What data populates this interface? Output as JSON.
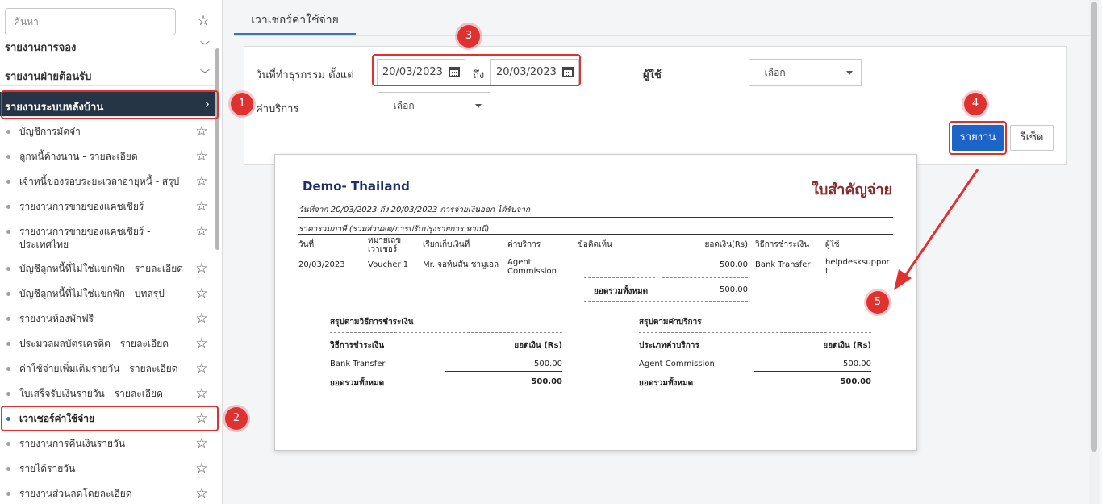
{
  "sidebar": {
    "search_placeholder": "ค้นหา",
    "sections": [
      {
        "label": "รายงานการจอง"
      },
      {
        "label": "รายงานฝ่ายต้อนรับ"
      },
      {
        "label": "รายงานระบบหลังบ้าน"
      }
    ],
    "items": [
      {
        "label": "บัญชีการมัดจำ"
      },
      {
        "label": "ลูกหนี้ค้างนาน - รายละเอียด"
      },
      {
        "label": "เจ้าหนี้ของรอบระยะเวลาอายุหนี้ - สรุป"
      },
      {
        "label": "รายงานการขายของแคชเชียร์"
      },
      {
        "label": "รายงานการขายของแคชเชียร์ -",
        "label2": "ประเทศไทย"
      },
      {
        "label": "บัญชีลูกหนี้ที่ไม่ใช่แขกพัก - รายละเอียด"
      },
      {
        "label": "บัญชีลูกหนี้ที่ไม่ใช่แขกพัก - บทสรุป"
      },
      {
        "label": "รายงานห้องพักฟรี"
      },
      {
        "label": "ประมวลผลบัตรเครดิต - รายละเอียด"
      },
      {
        "label": "ค่าใช้จ่ายเพิ่มเติมรายวัน - รายละเอียด"
      },
      {
        "label": "ใบเสร็จรับเงินรายวัน - รายละเอียด"
      },
      {
        "label": "เวาเชอร์ค่าใช้จ่าย"
      },
      {
        "label": "รายงานการคืนเงินรายวัน"
      },
      {
        "label": "รายได้รายวัน"
      },
      {
        "label": "รายงานส่วนลดโดยละเอียด"
      }
    ]
  },
  "main": {
    "tab_label": "เวาเชอร์ค่าใช้จ่าย",
    "filters": {
      "date_label": "วันที่ทำธุรกรรม ตั้งแต่",
      "date_from": "20/03/2023",
      "to_label": "ถึง",
      "date_to": "20/03/2023",
      "user_label": "ผู้ใช้",
      "user_value": "--เลือก--",
      "service_label": "ค่าบริการ",
      "service_value": "--เลือก--"
    },
    "buttons": {
      "report": "รายงาน",
      "reset": "รีเซ็ต"
    }
  },
  "document": {
    "company": "Demo- Thailand",
    "title": "ใบสำคัญจ่าย",
    "meta": "วันที่จาก  20/03/2023   ถึง  20/03/2023   การจ่ายเงินออก     ได้รับจาก",
    "note": "ราคารวมภาษี (รวมส่วนลด/การปรับปรุงรายการ หากมี)",
    "columns": [
      "วันที่",
      "หมายเลข\nเวาเชอร์",
      "เรียกเก็บเงินที่",
      "ค่าบริการ",
      "ข้อคิดเห็น",
      "ยอดเงิน(Rs)",
      "วิธีการชำระเงิน",
      "ผู้ใช้"
    ],
    "row": {
      "date": "20/03/2023",
      "voucher": "Voucher 1",
      "billed_to": "Mr. จอห์นสัน ชามูเอล",
      "service": "Agent\nCommission",
      "comment": "",
      "amount": "500.00",
      "payment": "Bank Transfer",
      "user": "helpdesksuppor\nt"
    },
    "total_label": "ยอดรวมทั้งหมด",
    "total_value": "500.00",
    "payment_summary": {
      "title": "สรุปตามวิธีการชำระเงิน",
      "col1": "วิธีการชำระเงิน",
      "col2": "ยอดเงิน (Rs)",
      "row_label": "Bank Transfer",
      "row_value": "500.00",
      "total_label": "ยอดรวมทั้งหมด",
      "total_value": "500.00"
    },
    "service_summary": {
      "title": "สรุปตามค่าบริการ",
      "col1": "ประเภทค่าบริการ",
      "col2": "ยอดเงิน (Rs)",
      "row_label": "Agent Commission",
      "row_value": "500.00",
      "total_label": "ยอดรวมทั้งหมด",
      "total_value": "500.00"
    }
  },
  "annotations": [
    "1",
    "2",
    "3",
    "4",
    "5"
  ],
  "colors": {
    "sidebar_active": "#263545",
    "accent": "#1e64c8",
    "callout": "#e03131",
    "doc_title": "#8b2a2a",
    "company": "#1f2d6b"
  }
}
